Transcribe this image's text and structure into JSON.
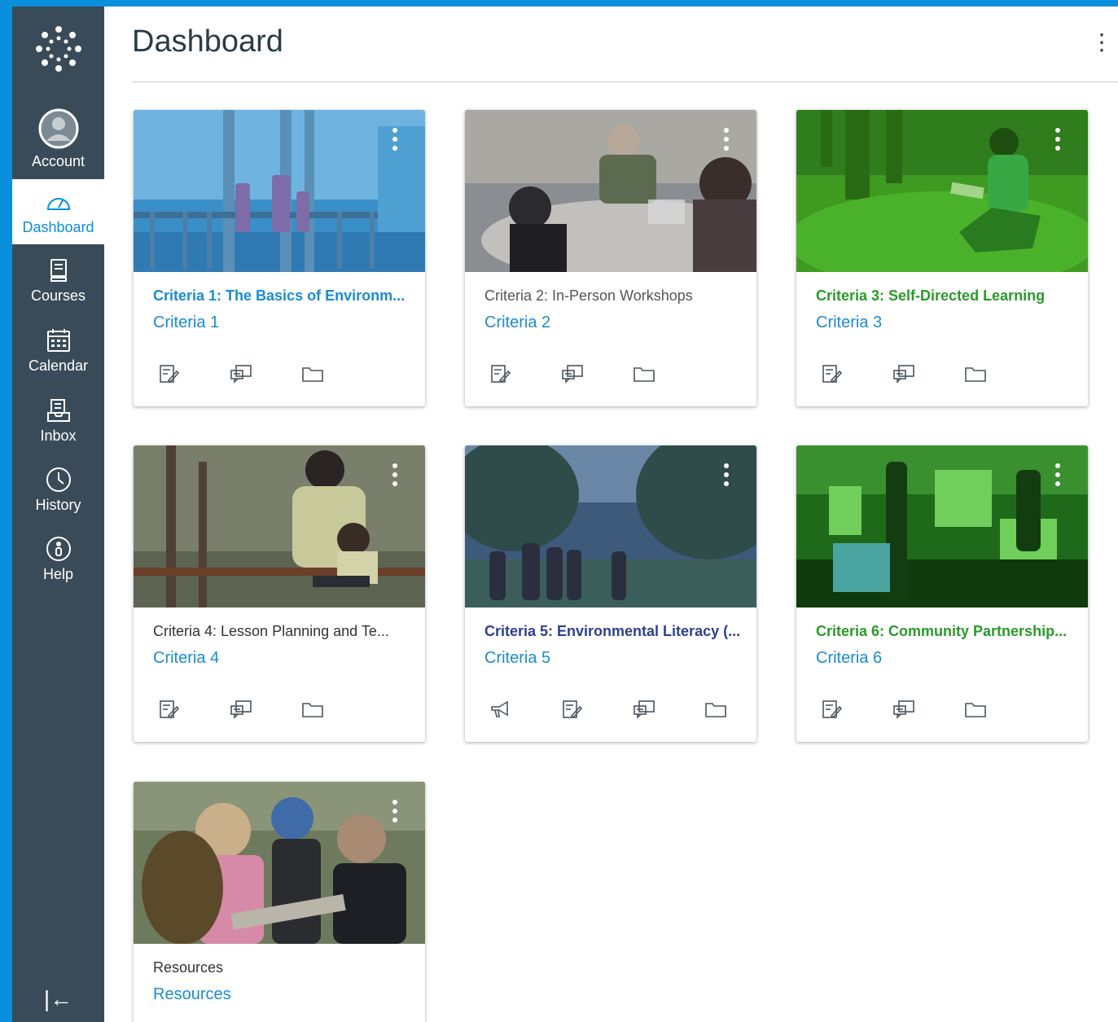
{
  "sidebar": {
    "items": [
      {
        "label": "Account",
        "icon": "account-icon"
      },
      {
        "label": "Dashboard",
        "icon": "dashboard-icon"
      },
      {
        "label": "Courses",
        "icon": "courses-icon"
      },
      {
        "label": "Calendar",
        "icon": "calendar-icon"
      },
      {
        "label": "Inbox",
        "icon": "inbox-icon"
      },
      {
        "label": "History",
        "icon": "history-icon"
      },
      {
        "label": "Help",
        "icon": "help-icon"
      }
    ],
    "collapse_glyph": "|←"
  },
  "header": {
    "title": "Dashboard"
  },
  "colors": {
    "brand": "#0a8fdc",
    "sidebar": "#394b58",
    "link": "#1a8bd2"
  },
  "cards": [
    {
      "name": "Criteria 1: The Basics of Environm...",
      "code": "Criteria 1",
      "name_color": "#1a8bd2"
    },
    {
      "name": "Criteria 2: In-Person Workshops",
      "code": "Criteria 2",
      "name_color": "#555555"
    },
    {
      "name": "Criteria 3: Self-Directed Learning",
      "code": "Criteria 3",
      "name_color": "#2a9a2a"
    },
    {
      "name": "Criteria 4: Lesson Planning and Te...",
      "code": "Criteria 4",
      "name_color": "#333333"
    },
    {
      "name": "Criteria 5: Environmental Literacy (...",
      "code": "Criteria 5",
      "name_color": "#2e3f8f"
    },
    {
      "name": "Criteria 6: Community Partnership...",
      "code": "Criteria 6",
      "name_color": "#2a9a2a"
    },
    {
      "name": "Resources",
      "code": "Resources",
      "name_color": "#333333"
    }
  ]
}
